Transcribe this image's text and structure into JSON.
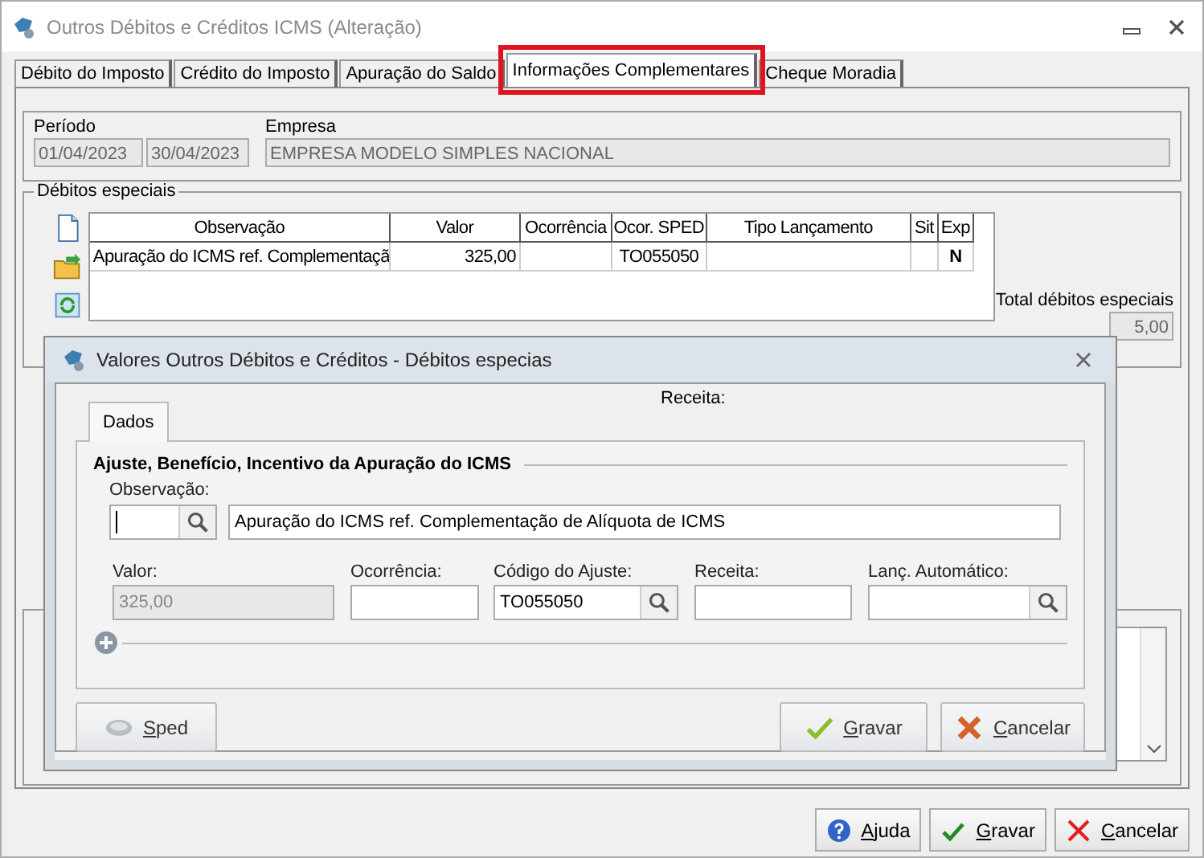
{
  "window": {
    "title": "Outros Débitos e Créditos ICMS (Alteração)"
  },
  "tabs": [
    {
      "label": "Débito do Imposto",
      "selected": false,
      "highlighted": false
    },
    {
      "label": "Crédito do Imposto",
      "selected": false,
      "highlighted": false
    },
    {
      "label": "Apuração do Saldo",
      "selected": false,
      "highlighted": false
    },
    {
      "label": "Informações Complementares",
      "selected": true,
      "highlighted": true
    },
    {
      "label": "Cheque Moradia",
      "selected": false,
      "highlighted": false
    }
  ],
  "periodo": {
    "label": "Período",
    "start": "01/04/2023",
    "end": "30/04/2023"
  },
  "empresa": {
    "label": "Empresa",
    "value": "EMPRESA MODELO SIMPLES NACIONAL"
  },
  "debitos": {
    "title": "Débitos especiais",
    "columns": [
      "Observação",
      "Valor",
      "Ocorrência",
      "Ocor. SPED",
      "Tipo Lançamento",
      "Sit",
      "Exp"
    ],
    "rows": [
      [
        "Apuração do ICMS ref. Complementaçã",
        "325,00",
        "",
        "TO055050",
        "",
        "",
        "N"
      ]
    ],
    "total_label": "Total débitos especiais",
    "total_value": "5,00"
  },
  "dialog": {
    "title": "Valores Outros Débitos e Créditos - Débitos especias",
    "receita_label": "Receita:",
    "tabs": [
      {
        "label": "Dados",
        "selected": true
      }
    ],
    "section": "Ajuste, Benefício, Incentivo da Apuração do ICMS",
    "observacao": {
      "label": "Observação:",
      "text": "Apuração do ICMS ref. Complementação de Alíquota de ICMS"
    },
    "fields": [
      {
        "label": "Valor:",
        "value": "325,00",
        "disabled": true,
        "search": false
      },
      {
        "label": "Ocorrência:",
        "disabled": false,
        "search": false
      },
      {
        "label": "Código do Ajuste:",
        "value": "TO055050",
        "disabled": false,
        "search": true
      },
      {
        "label": "Receita:",
        "disabled": false,
        "search": false
      },
      {
        "label": "Lanç. Automático:",
        "disabled": false,
        "search": true
      }
    ],
    "buttons": [
      {
        "label": "Sped",
        "kind": "sped"
      },
      {
        "label": "Gravar",
        "kind": "save"
      },
      {
        "label": "Cancelar",
        "kind": "cancel"
      }
    ]
  },
  "buttons": [
    {
      "label": "Ajuda",
      "kind": "help"
    },
    {
      "label": "Gravar",
      "kind": "save"
    },
    {
      "label": "Cancelar",
      "kind": "cancel"
    }
  ]
}
